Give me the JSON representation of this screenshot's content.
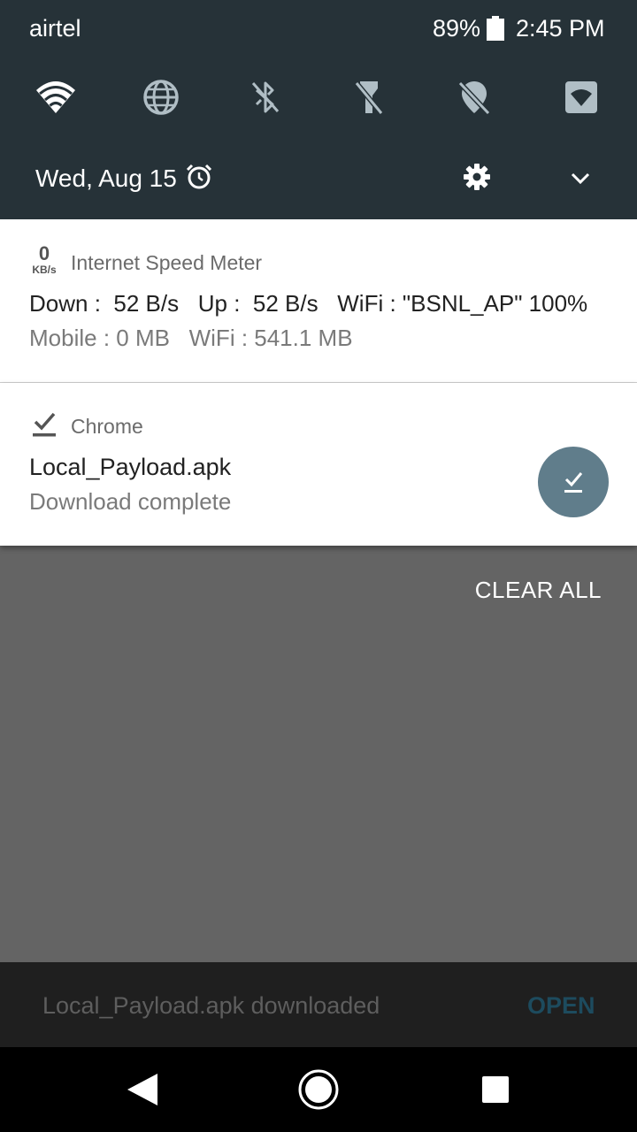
{
  "status_bar": {
    "carrier": "airtel",
    "battery_percent": "89%",
    "time": "2:45 PM"
  },
  "quick_settings": {
    "tiles": [
      "wifi-icon",
      "globe-icon",
      "bluetooth-off-icon",
      "flashlight-off-icon",
      "location-off-icon",
      "hotspot-icon"
    ],
    "date": "Wed, Aug 15"
  },
  "notifications": {
    "speed_meter": {
      "icon_value": "0",
      "icon_unit": "KB/s",
      "app_name": "Internet Speed Meter",
      "line1": "Down :  52 B/s   Up :  52 B/s   WiFi : \"BSNL_AP\" 100%",
      "line2": "Mobile : 0 MB   WiFi : 541.1 MB"
    },
    "chrome": {
      "app_name": "Chrome",
      "title": "Local_Payload.apk",
      "status": "Download complete"
    },
    "clear_all": "CLEAR ALL"
  },
  "snackbar": {
    "message": "Local_Payload.apk downloaded",
    "action": "OPEN"
  },
  "colors": {
    "shade_background": "#263238",
    "scrim": "#646464",
    "download_action": "#607d8b",
    "snackbar_action": "#1d4b5e"
  }
}
